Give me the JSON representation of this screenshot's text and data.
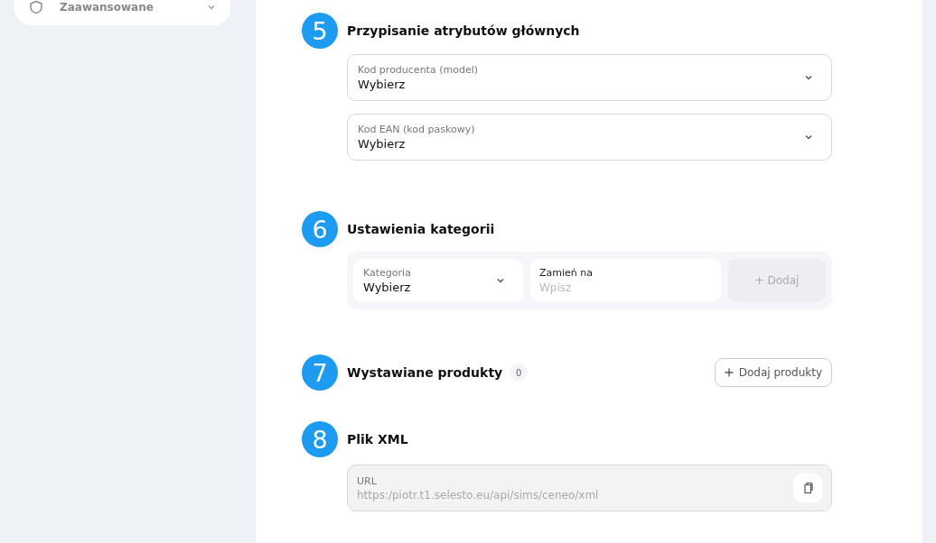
{
  "sidebar": {
    "items": [
      {
        "label": "Zaawansowane",
        "expanded": false
      }
    ]
  },
  "sections": [
    {
      "number": "5",
      "title": "Przypisanie atrybutów głównych",
      "kind": "selects",
      "selects": [
        {
          "label": "Kod producenta (model)",
          "value": "Wybierz"
        },
        {
          "label": "Kod EAN (kod paskowy)",
          "value": "Wybierz"
        }
      ]
    },
    {
      "number": "6",
      "title": "Ustawienia kategorii",
      "kind": "category",
      "category": {
        "label": "Kategoria",
        "value": "Wybierz"
      },
      "replace": {
        "label": "Zamień na",
        "placeholder": "Wpisz"
      },
      "add_button": {
        "label": "+ Dodaj",
        "disabled": true
      }
    },
    {
      "number": "7",
      "title": "Wystawiane produkty",
      "kind": "products",
      "count": "0",
      "add_button": {
        "label": "Dodaj produkty"
      }
    },
    {
      "number": "8",
      "title": "Plik XML",
      "kind": "xml",
      "url": {
        "label": "URL",
        "value": "https:/piotr.t1.selesto.eu/api/sims/ceneo/xml"
      }
    }
  ]
}
